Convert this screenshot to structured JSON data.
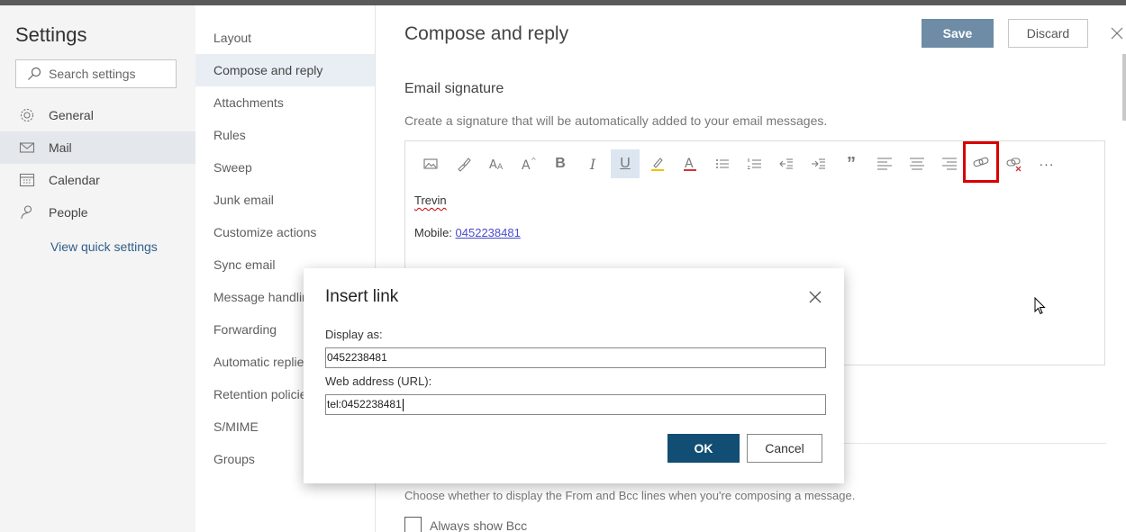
{
  "sidebar": {
    "title": "Settings",
    "search_placeholder": "Search settings",
    "items": [
      {
        "label": "General",
        "icon": "gear-icon"
      },
      {
        "label": "Mail",
        "icon": "mail-icon"
      },
      {
        "label": "Calendar",
        "icon": "calendar-icon"
      },
      {
        "label": "People",
        "icon": "people-icon"
      }
    ],
    "quick_settings": "View quick settings"
  },
  "subnav": {
    "items": [
      "Layout",
      "Compose and reply",
      "Attachments",
      "Rules",
      "Sweep",
      "Junk email",
      "Customize actions",
      "Sync email",
      "Message handling",
      "Forwarding",
      "Automatic replies",
      "Retention policies",
      "S/MIME",
      "Groups"
    ]
  },
  "main": {
    "title": "Compose and reply",
    "save_label": "Save",
    "discard_label": "Discard",
    "section_title": "Email signature",
    "section_desc": "Create a signature that will be automatically added to your email messages.",
    "signature_name": "Trevin",
    "mobile_label": "Mobile: ",
    "mobile_number": "0452238481 ",
    "choose_text": "Choose whether to display the From and Bcc lines when you're composing a message.",
    "always_bcc": "Always show Bcc"
  },
  "toolbar": {
    "format_bold": "B",
    "format_italic": "I",
    "format_underline": "U",
    "quote": "”",
    "more": "···"
  },
  "dialog": {
    "title": "Insert link",
    "display_label": "Display as:",
    "display_value": "0452238481",
    "url_label": "Web address (URL):",
    "url_value": "tel:0452238481",
    "ok_label": "OK",
    "cancel_label": "Cancel"
  },
  "colors": {
    "accent": "#124d73",
    "highlight_box": "#d80000",
    "save_button": "#6e8ca6"
  }
}
